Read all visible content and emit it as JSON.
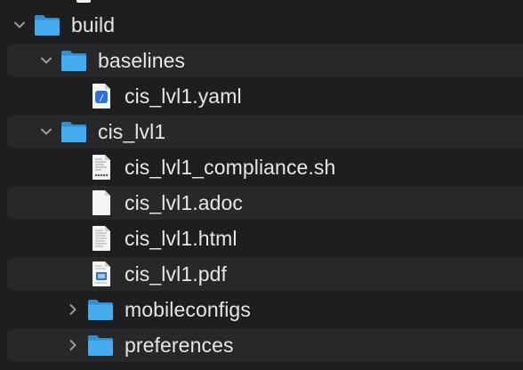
{
  "colors": {
    "background": "#1e1e20",
    "stripe": "#28282a",
    "folder": "#3aa3e6",
    "text": "#e6e6e8",
    "chevron": "#9a9a9e"
  },
  "tree": [
    {
      "label": "build",
      "kind": "folder",
      "expanded": true,
      "icon": "folder-icon"
    },
    {
      "label": "baselines",
      "kind": "folder",
      "expanded": true,
      "icon": "folder-icon"
    },
    {
      "label": "cis_lvl1.yaml",
      "kind": "file",
      "icon": "yaml-file-icon"
    },
    {
      "label": "cis_lvl1",
      "kind": "folder",
      "expanded": true,
      "icon": "folder-icon"
    },
    {
      "label": "cis_lvl1_compliance.sh",
      "kind": "file",
      "icon": "shell-script-icon"
    },
    {
      "label": "cis_lvl1.adoc",
      "kind": "file",
      "icon": "blank-document-icon"
    },
    {
      "label": "cis_lvl1.html",
      "kind": "file",
      "icon": "html-document-icon"
    },
    {
      "label": "cis_lvl1.pdf",
      "kind": "file",
      "icon": "pdf-document-icon"
    },
    {
      "label": "mobileconfigs",
      "kind": "folder",
      "expanded": false,
      "icon": "folder-icon"
    },
    {
      "label": "preferences",
      "kind": "folder",
      "expanded": false,
      "icon": "folder-icon"
    }
  ]
}
